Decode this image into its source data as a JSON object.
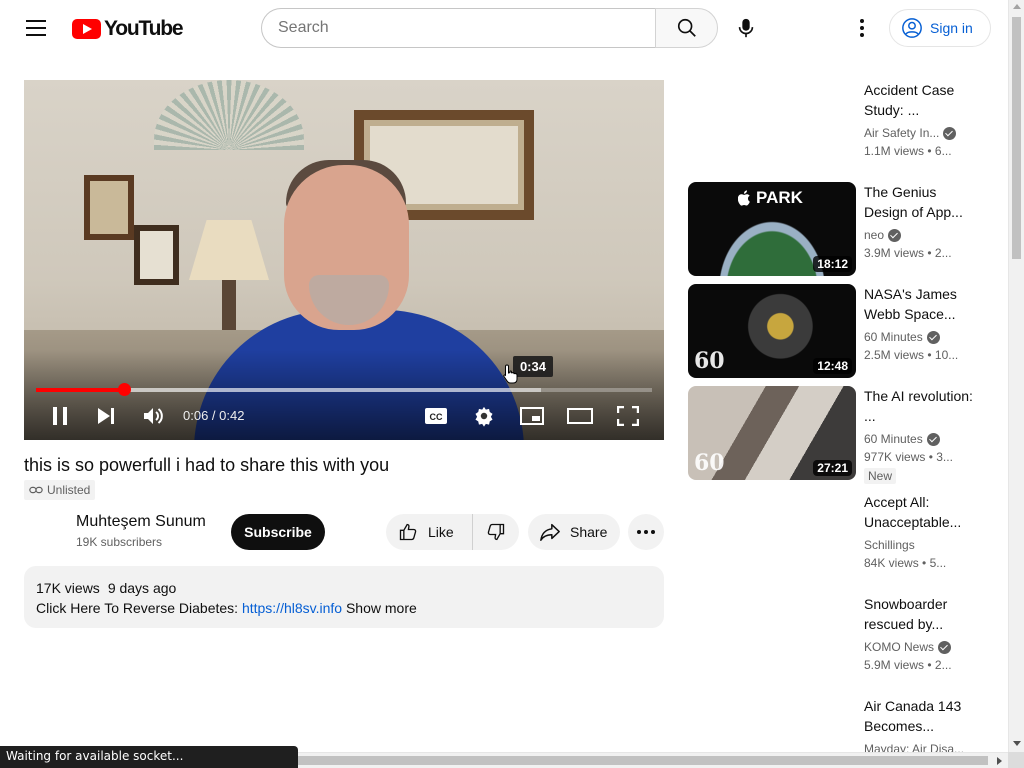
{
  "header": {
    "logo_text": "YouTube",
    "search_placeholder": "Search",
    "signin_label": "Sign in"
  },
  "player": {
    "current_time": "0:06",
    "duration": "0:42",
    "time_separator": " / ",
    "progress_fraction": 0.143,
    "loaded_fraction": 0.82,
    "hover_time": "0:34",
    "hover_fraction": 0.81
  },
  "video": {
    "title": "this is so powerfull i had to share this with you",
    "visibility": "Unlisted",
    "channel_name": "Muhteşem Sunum",
    "subscribers": "19K subscribers",
    "subscribe_label": "Subscribe",
    "like_label": "Like",
    "share_label": "Share",
    "views": "17K views",
    "age": "9 days ago",
    "description_text": "Click Here To Reverse Diabetes: ",
    "description_link": "https://hl8sv.info",
    "show_more": "Show more"
  },
  "recommendations": [
    {
      "title": "Accident Case Study: ...",
      "channel": "Air Safety In...",
      "verified": true,
      "views": "1.1M views",
      "age": "• 6...",
      "duration": "",
      "thumb": "hidden"
    },
    {
      "title": "The Genius Design of App...",
      "channel": "neo",
      "verified": true,
      "views": "3.9M views",
      "age": "• 2...",
      "duration": "18:12",
      "thumb": "park",
      "thumb_label": "PARK"
    },
    {
      "title": "NASA's James Webb Space...",
      "channel": "60 Minutes",
      "verified": true,
      "views": "2.5M views",
      "age": "• 10...",
      "duration": "12:48",
      "thumb": "webb",
      "thumb_label": "60"
    },
    {
      "title": "The AI revolution: ...",
      "channel": "60 Minutes",
      "verified": true,
      "views": "977K views",
      "age": "• 3...",
      "duration": "27:21",
      "thumb": "ai",
      "thumb_label": "60",
      "badge": "New"
    },
    {
      "title": "Accept All: Unacceptable...",
      "channel": "Schillings",
      "verified": false,
      "views": "84K views",
      "age": "• 5...",
      "duration": "",
      "thumb": "hidden"
    },
    {
      "title": "Snowboarder rescued by...",
      "channel": "KOMO News",
      "verified": true,
      "views": "5.9M views",
      "age": "• 2...",
      "duration": "",
      "thumb": "hidden"
    },
    {
      "title": "Air Canada 143 Becomes...",
      "channel": "Mayday: Air Disa...",
      "verified": false,
      "views": "",
      "age": "",
      "duration": "",
      "thumb": "hidden"
    }
  ],
  "status_bar": "Waiting for available socket...",
  "colors": {
    "brand_red": "#ff0000",
    "link_blue": "#065fd4",
    "text_primary": "#0f0f0f",
    "text_secondary": "#606060"
  }
}
